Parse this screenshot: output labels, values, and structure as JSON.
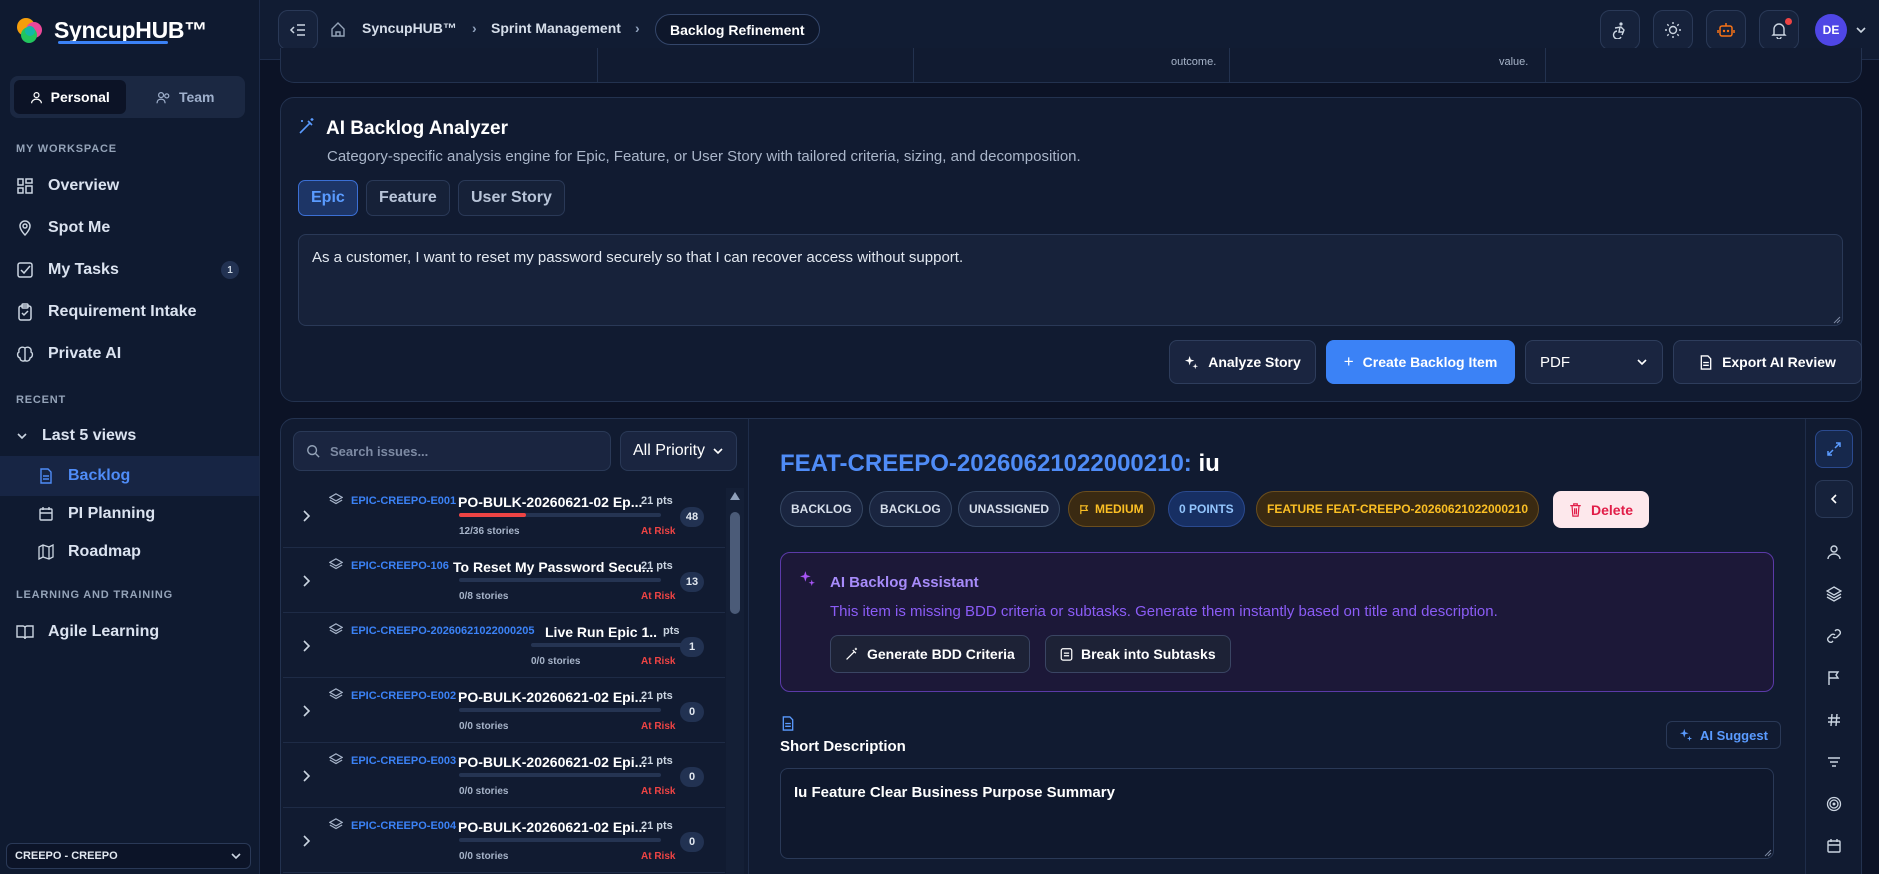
{
  "app": {
    "name": "SyncupHUB™",
    "name_a": "Syncup",
    "name_b": "HUB",
    "name_c": "™"
  },
  "sidebar": {
    "mode_personal": "Personal",
    "mode_team": "Team",
    "section_workspace": "MY WORKSPACE",
    "items": [
      {
        "label": "Overview",
        "icon": "grid-icon"
      },
      {
        "label": "Spot Me",
        "icon": "location-pin-icon"
      },
      {
        "label": "My Tasks",
        "icon": "checkbox-icon",
        "badge": "1"
      },
      {
        "label": "Requirement Intake",
        "icon": "clipboard-icon"
      },
      {
        "label": "Private AI",
        "icon": "brain-icon"
      }
    ],
    "section_recent": "RECENT",
    "recent_group": "Last 5 views",
    "recent_items": [
      {
        "label": "Backlog",
        "icon": "document-icon"
      },
      {
        "label": "PI Planning",
        "icon": "calendar-icon"
      },
      {
        "label": "Roadmap",
        "icon": "map-icon"
      }
    ],
    "section_learning": "LEARNING AND TRAINING",
    "learning_items": [
      {
        "label": "Agile Learning",
        "icon": "book-icon"
      }
    ],
    "org_select": "CREEPO - CREEPO"
  },
  "topbar": {
    "breadcrumb": [
      "SyncupHUB™",
      "Sprint Management",
      "Backlog Refinement"
    ],
    "avatar": "DE"
  },
  "top_table_fragment": {
    "cell_a": "outcome.",
    "cell_b": "value."
  },
  "analyzer": {
    "title": "AI Backlog Analyzer",
    "subtitle": "Category-specific analysis engine for Epic, Feature, or User Story with tailored criteria, sizing, and decomposition.",
    "tabs": [
      "Epic",
      "Feature",
      "User Story"
    ],
    "active_tab": "Epic",
    "input_value": "As a customer, I want to reset my password securely so that I can recover access without support.",
    "analyze_label": "Analyze Story",
    "create_label": "Create Backlog Item",
    "export_format": "PDF",
    "export_label": "Export AI Review"
  },
  "issues": {
    "search_placeholder": "Search issues...",
    "priority_filter": "All Priority",
    "rows": [
      {
        "key": "EPIC-CREEPO-E001",
        "title": "PO-BULK-20260621-02 Ep...",
        "pts": "21 pts",
        "stories": "12/36 stories",
        "progress": 0.33,
        "risk": "At Risk",
        "count": "48"
      },
      {
        "key": "EPIC-CREEPO-106",
        "title": "To Reset My Password Secu...",
        "pts": "21 pts",
        "stories": "0/8 stories",
        "progress": 0,
        "risk": "At Risk",
        "count": "13"
      },
      {
        "key": "EPIC-CREEPO-20260621022000205",
        "title": "Live Run Epic 1...",
        "pts": "pts",
        "stories": "0/0 stories",
        "progress": 0,
        "risk": "At Risk",
        "count": "1"
      },
      {
        "key": "EPIC-CREEPO-E002",
        "title": "PO-BULK-20260621-02 Epi...",
        "pts": "21 pts",
        "stories": "0/0 stories",
        "progress": 0,
        "risk": "At Risk",
        "count": "0"
      },
      {
        "key": "EPIC-CREEPO-E003",
        "title": "PO-BULK-20260621-02 Epi...",
        "pts": "21 pts",
        "stories": "0/0 stories",
        "progress": 0,
        "risk": "At Risk",
        "count": "0"
      },
      {
        "key": "EPIC-CREEPO-E004",
        "title": "PO-BULK-20260621-02 Epi...",
        "pts": "21 pts",
        "stories": "0/0 stories",
        "progress": 0,
        "risk": "At Risk",
        "count": "0"
      }
    ]
  },
  "detail": {
    "key": "FEAT-CREEPO-20260621022000210:",
    "title": "iu",
    "tags": [
      "BACKLOG",
      "BACKLOG",
      "UNASSIGNED",
      "MEDIUM",
      "0 POINTS",
      "FEATURE FEAT-CREEPO-20260621022000210"
    ],
    "delete_label": "Delete",
    "assistant": {
      "title": "AI Backlog Assistant",
      "message": "This item is missing BDD criteria or subtasks. Generate them instantly based on title and description.",
      "generate_label": "Generate BDD Criteria",
      "split_label": "Break into Subtasks"
    },
    "short_desc_label": "Short Description",
    "ai_suggest_label": "AI Suggest",
    "short_desc_value": "Iu Feature Clear Business Purpose Summary"
  },
  "colors": {
    "accent": "#3b82f6",
    "danger": "#ef4444",
    "warning": "#fbbf24",
    "purple": "#8b5cf6"
  }
}
